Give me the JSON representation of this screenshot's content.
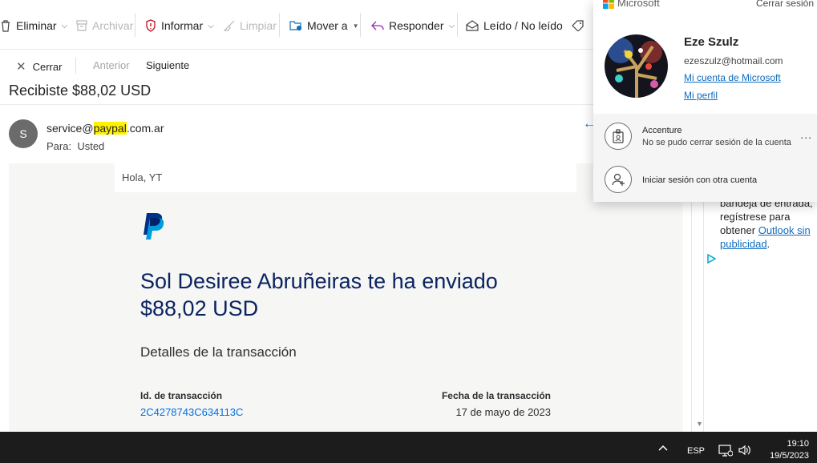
{
  "toolbar": {
    "delete_label": "Eliminar",
    "archive_label": "Archivar",
    "report_label": "Informar",
    "sweep_label": "Limpiar",
    "move_label": "Mover a",
    "reply_label": "Responder",
    "read_unread_label": "Leído / No leído"
  },
  "nav": {
    "close_label": "Cerrar",
    "prev_label": "Anterior",
    "next_label": "Siguiente"
  },
  "message": {
    "subject": "Recibiste $88,02 USD",
    "avatar_initial": "S",
    "sender_prefix": "service@",
    "sender_highlight": "paypal",
    "sender_suffix": ".com.ar",
    "to_label": "Para:",
    "to_value": "Usted"
  },
  "email_body": {
    "greeting": "Hola, YT",
    "headline": "Sol Desiree Abruñeiras te ha enviado $88,02 USD",
    "details_title": "Detalles de la transacción",
    "txn_id_label": "Id. de transacción",
    "txn_id_value": "2C4278743C634113C",
    "txn_date_label": "Fecha de la transacción",
    "txn_date_value": "17 de mayo de 2023"
  },
  "ad": {
    "text_line1": "bandeja de entrada,",
    "text_line2": "regístrese para",
    "text_line3": "obtener",
    "link_text": "Outlook sin publicidad",
    "suffix": "."
  },
  "flyout": {
    "brand": "Microsoft",
    "signout_label": "Cerrar sesión",
    "user_name": "Eze Szulz",
    "user_email": "ezeszulz@hotmail.com",
    "ms_account_link": "Mi cuenta de Microsoft",
    "profile_link": "Mi perfil",
    "account_name": "Accenture",
    "account_status": "No se pudo cerrar sesión de la cuenta",
    "more_label": "...",
    "other_account_label": "Iniciar sesión con otra cuenta"
  },
  "taskbar": {
    "language": "ESP",
    "time": "19:10",
    "date": "19/5/2023"
  },
  "colors": {
    "accent": "#0f6cbd",
    "paypal_navy": "#0a2360",
    "paypal_blue": "#0070e0",
    "highlight": "#fff100"
  }
}
